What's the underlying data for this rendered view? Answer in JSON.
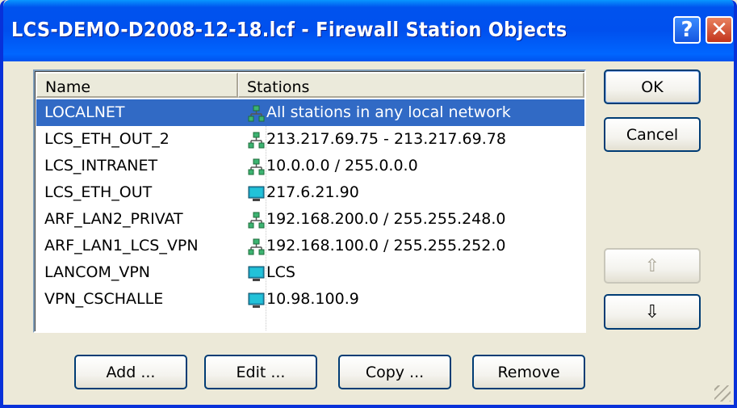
{
  "window": {
    "title": "LCS-DEMO-D2008-12-18.lcf - Firewall Station Objects",
    "help_glyph": "?",
    "close_glyph": "✕"
  },
  "list": {
    "columns": [
      "Name",
      "Stations"
    ],
    "rows": [
      {
        "name": "LOCALNET",
        "station": "All stations in any local network",
        "icon": "network-icon",
        "selected": true
      },
      {
        "name": "LCS_ETH_OUT_2",
        "station": "213.217.69.75 - 213.217.69.78",
        "icon": "network-icon"
      },
      {
        "name": "LCS_INTRANET",
        "station": "10.0.0.0 / 255.0.0.0",
        "icon": "network-icon"
      },
      {
        "name": "LCS_ETH_OUT",
        "station": "217.6.21.90",
        "icon": "computer-icon"
      },
      {
        "name": "ARF_LAN2_PRIVAT",
        "station": "192.168.200.0 / 255.255.248.0",
        "icon": "network-icon"
      },
      {
        "name": "ARF_LAN1_LCS_VPN",
        "station": "192.168.100.0 / 255.255.252.0",
        "icon": "network-icon"
      },
      {
        "name": "LANCOM_VPN",
        "station": "LCS",
        "icon": "computer-icon"
      },
      {
        "name": "VPN_CSCHALLE",
        "station": "10.98.100.9",
        "icon": "computer-icon"
      }
    ]
  },
  "buttons": {
    "ok": "OK",
    "cancel": "Cancel",
    "up": "⇧",
    "down": "⇩",
    "add": "Add ...",
    "edit": "Edit ...",
    "copy": "Copy ...",
    "remove": "Remove"
  },
  "colors": {
    "selection": "#316ac5",
    "titlebar": "#0053ee"
  }
}
